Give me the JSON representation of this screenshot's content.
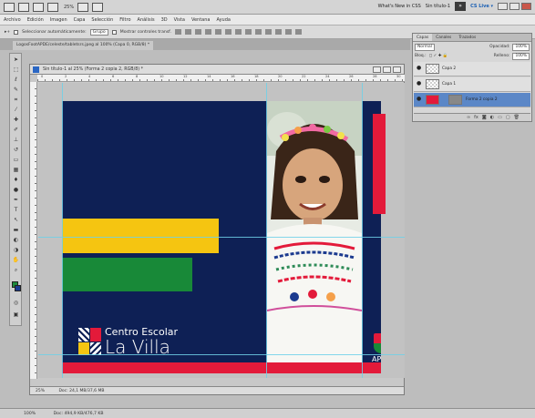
{
  "appbar": {
    "zoom": "25%",
    "whats_new": "What's New in CSS",
    "doc_name": "Sin título-1",
    "cs_live": "CS Live ▾"
  },
  "menu": [
    "Archivo",
    "Edición",
    "Imagen",
    "Capa",
    "Selección",
    "Filtro",
    "Análisis",
    "3D",
    "Vista",
    "Ventana",
    "Ayuda"
  ],
  "options": {
    "auto_select": "Seleccionar automáticamente:",
    "auto_select_value": "Grupo",
    "transform_controls": "Mostrar controles transf."
  },
  "doc_tab": "LogosFootAPDE/celeste/tabletsrs.jpeg al 100% (Capa 0, RGB/8) *",
  "doc_window": {
    "title": "Sin título-1 al 25% (Forma 2 copia 2, RGB/8) *",
    "zoom": "25%",
    "doc_size": "Doc: 24,1 MB/37,6 MB"
  },
  "ruler_numbers": [
    "0",
    "2",
    "4",
    "6",
    "8",
    "10",
    "12",
    "14",
    "16",
    "18",
    "20",
    "22",
    "24",
    "26",
    "28",
    "30"
  ],
  "artwork": {
    "logo_line1": "Centro Escolar",
    "logo_line2": "La Villa",
    "apde": "APDE",
    "colors": {
      "navy": "#0e2055",
      "yellow": "#f5c511",
      "green": "#188938",
      "red": "#e31a3a"
    }
  },
  "layers_panel": {
    "tabs": [
      "Capas",
      "Canales",
      "Trazados"
    ],
    "blend_mode": "Normal",
    "opacity_label": "Opacidad:",
    "opacity_value": "100%",
    "lock_label": "Bloq.:",
    "fill_label": "Relleno:",
    "fill_value": "100%",
    "layers": [
      "Capa 2",
      "Capa 1",
      "Forma 2 copia 2"
    ]
  },
  "statusbar": {
    "zoom": "100%",
    "doc_size": "Doc: 494,9 KB/476,7 KB"
  }
}
